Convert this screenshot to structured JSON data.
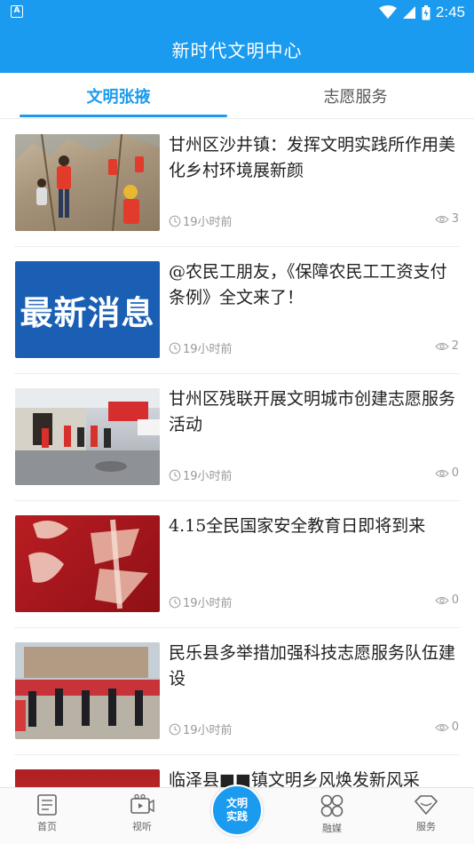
{
  "status": {
    "time": "2:45"
  },
  "header": {
    "title": "新时代文明中心"
  },
  "tabs": [
    {
      "label": "文明张掖"
    },
    {
      "label": "志愿服务"
    }
  ],
  "articles": [
    {
      "title": "甘州区沙井镇：发挥文明实践所作用美化乡村环境展新颜",
      "time": "19小时前",
      "views": "3"
    },
    {
      "title": "@农民工朋友，《保障农民工工资支付条例》全文来了！",
      "time": "19小时前",
      "views": "2",
      "thumb_text": "最新消息"
    },
    {
      "title": "甘州区残联开展文明城市创建志愿服务活动",
      "time": "19小时前",
      "views": "0"
    },
    {
      "title": "4.15全民国家安全教育日即将到来",
      "time": "19小时前",
      "views": "0"
    },
    {
      "title": "民乐县多举措加强科技志愿服务队伍建设",
      "time": "19小时前",
      "views": "0"
    },
    {
      "title": "临泽县■■镇文明乡风焕发新风采",
      "time": "",
      "views": ""
    }
  ],
  "bottom_nav": [
    {
      "label": "首页"
    },
    {
      "label": "视听"
    },
    {
      "label": "文明实践"
    },
    {
      "label": "融媒"
    },
    {
      "label": "服务"
    }
  ],
  "colors": {
    "primary": "#1a9bef"
  }
}
